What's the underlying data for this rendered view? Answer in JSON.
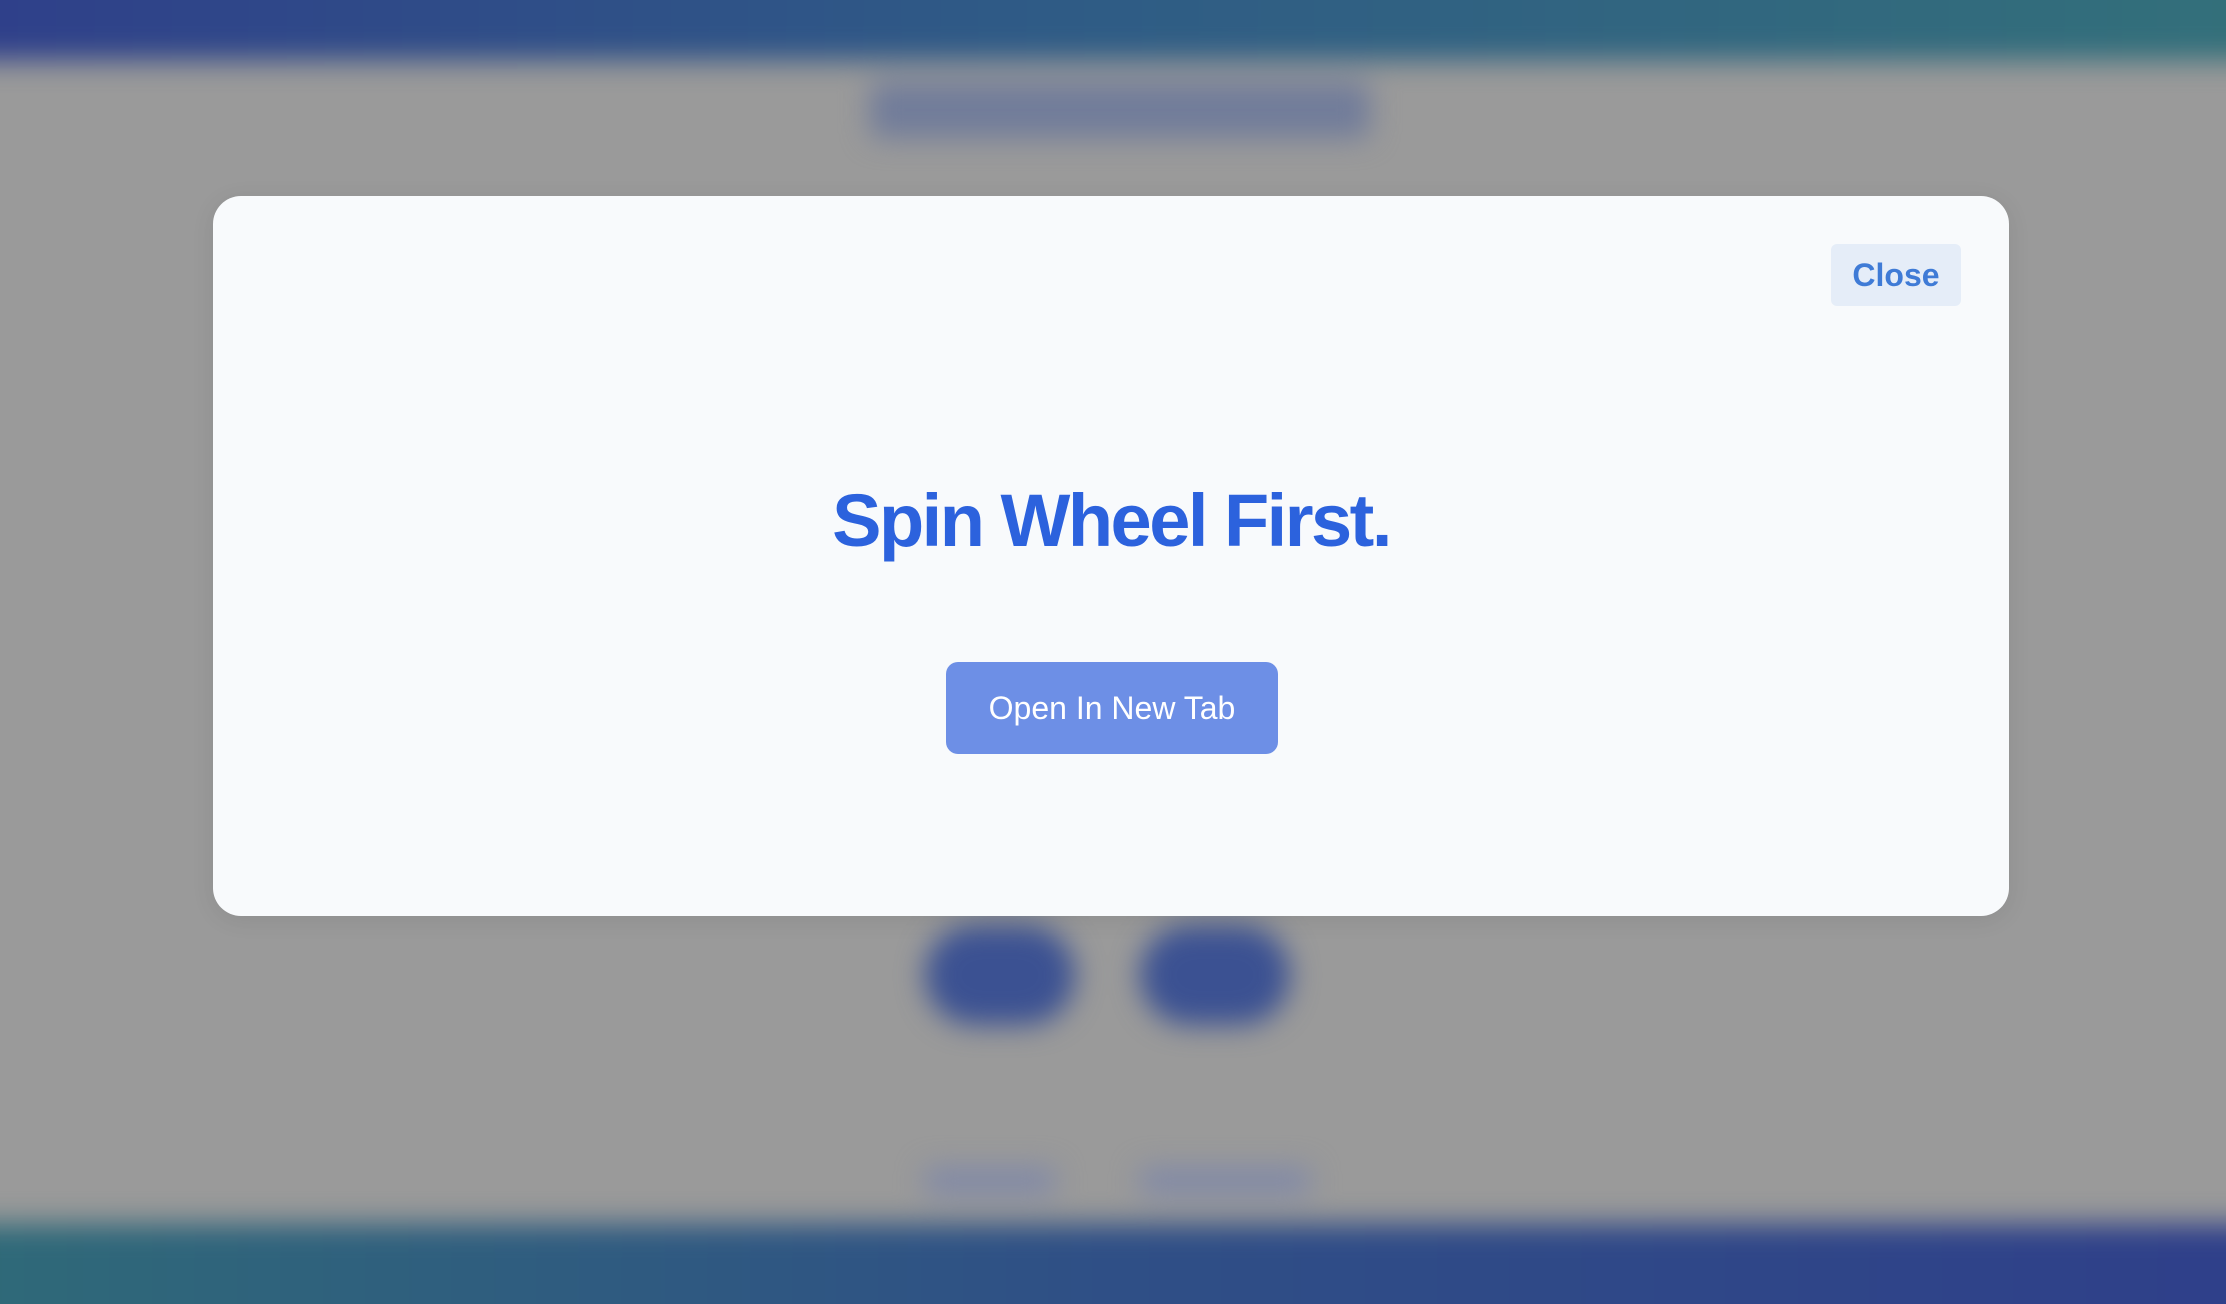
{
  "modal": {
    "close_label": "Close",
    "title": "Spin Wheel First.",
    "open_tab_label": "Open In New Tab"
  },
  "colors": {
    "title": "#2c62dd",
    "primary_button": "#6d8fe6",
    "close_button_bg": "#e5edf8",
    "close_button_text": "#3f7bd6",
    "overlay": "#9a9a9a"
  }
}
